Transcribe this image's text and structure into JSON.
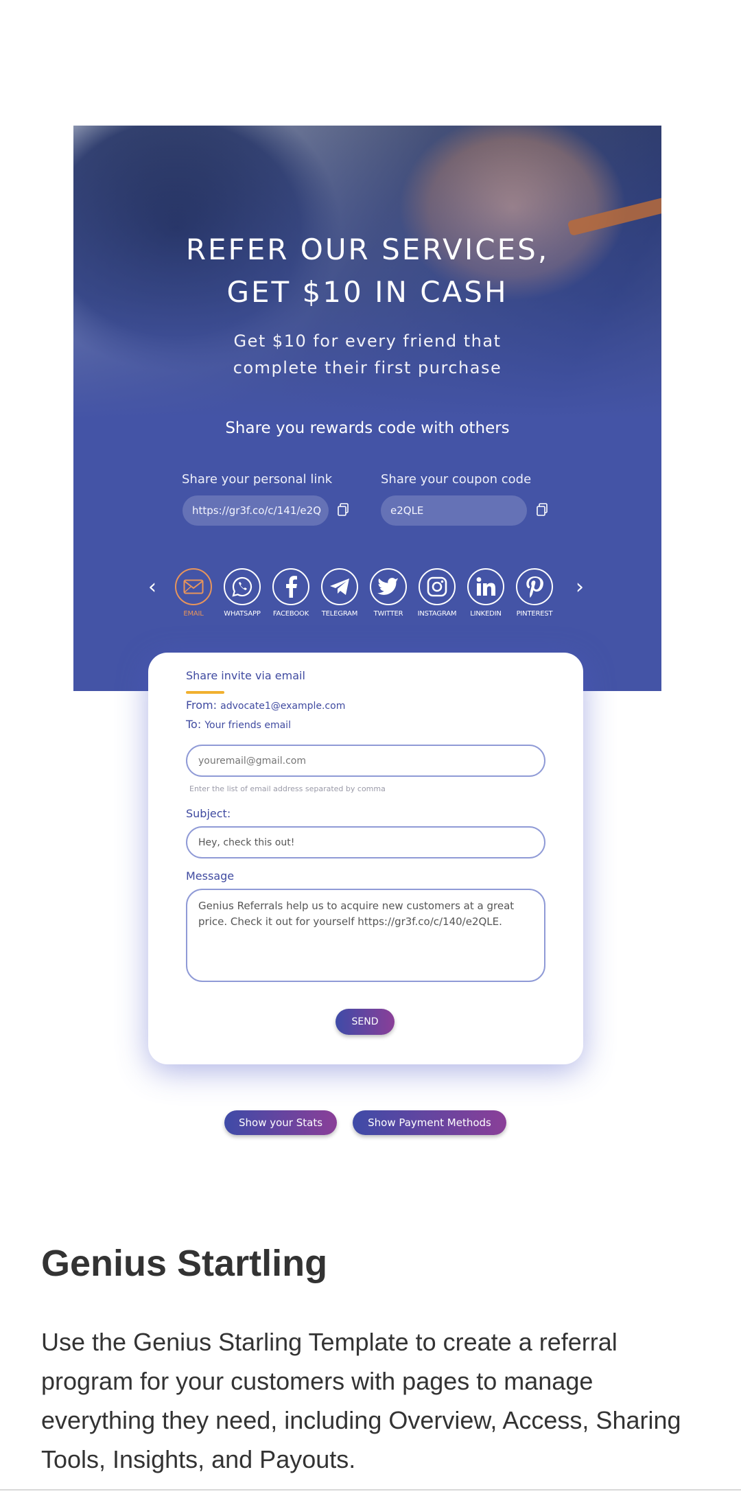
{
  "hero": {
    "title": "REFER OUR SERVICES,\nGET $10 IN CASH",
    "subtitle": "Get $10 for every friend that\ncomplete their first purchase",
    "share_title": "Share you rewards code with others",
    "personal_link_label": "Share your personal link",
    "personal_link_value": "https://gr3f.co/c/141/e2Q",
    "coupon_label": "Share your coupon code",
    "coupon_value": "e2QLE"
  },
  "social": [
    {
      "label": "EMAIL",
      "icon": "email-icon",
      "active": true
    },
    {
      "label": "WHATSAPP",
      "icon": "whatsapp-icon"
    },
    {
      "label": "FACEBOOK",
      "icon": "facebook-icon"
    },
    {
      "label": "TELEGRAM",
      "icon": "telegram-icon"
    },
    {
      "label": "TWITTER",
      "icon": "twitter-icon"
    },
    {
      "label": "INSTAGRAM",
      "icon": "instagram-icon"
    },
    {
      "label": "LINKEDIN",
      "icon": "linkedin-icon"
    },
    {
      "label": "PINTEREST",
      "icon": "pinterest-icon"
    }
  ],
  "email_form": {
    "title": "Share invite via email",
    "from_label": "From:",
    "from_value": "advocate1@example.com",
    "to_label": "To:",
    "to_value": "Your friends email",
    "to_placeholder": "youremail@gmail.com",
    "to_hint": "Enter the list of email address separated by comma",
    "subject_label": "Subject:",
    "subject_value": "Hey, check this out!",
    "message_label": "Message",
    "message_value": "Genius Referrals help us to acquire new customers at a great price. Check it out for yourself https://gr3f.co/c/140/e2QLE.",
    "send_label": "SEND"
  },
  "actions": {
    "stats_label": "Show your Stats",
    "payment_label": "Show Payment Methods"
  },
  "bottom": {
    "title": "Genius Startling",
    "description": "Use the Genius Starling Template to create a referral program for your customers with pages to manage everything they need, including Overview, Access, Sharing Tools, Insights, and Payouts."
  },
  "colors": {
    "hero_blue": "#4454a6",
    "accent_orange": "#e8955b",
    "underline_yellow": "#f1b02f",
    "button_gradient_start": "#3f4ba7",
    "button_gradient_end": "#8a3f98"
  }
}
